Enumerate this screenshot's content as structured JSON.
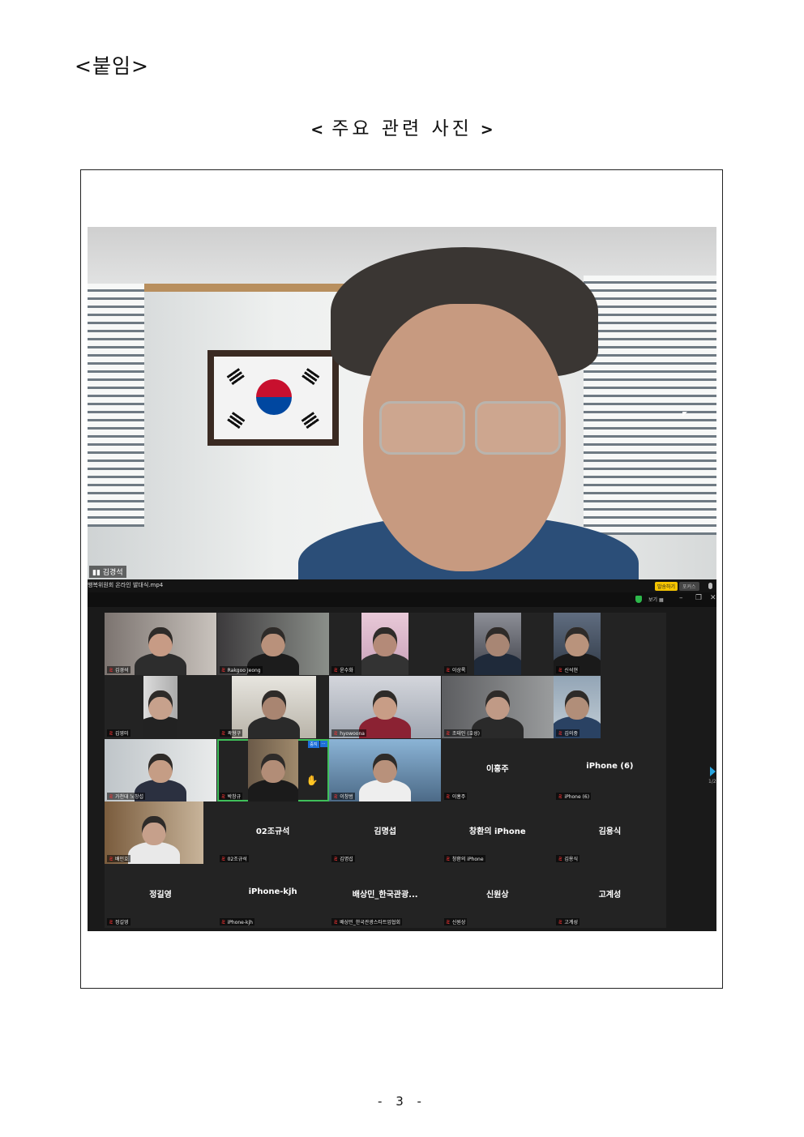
{
  "document": {
    "attachment_title": "<붙임>",
    "heading_open": "<",
    "heading_text": "주요 관련 사진",
    "heading_close": ">",
    "page_number": "- 3 -"
  },
  "speaker_view": {
    "speaker_name": "김경석"
  },
  "zoom_window": {
    "file_name": "행복위원회 온라인 발대식.mp4",
    "record_badge": "발송하기",
    "focus_button": "포커스",
    "view_button": "보기 ▦",
    "minimize": "–",
    "restore": "❐",
    "close": "✕",
    "page_indicator": "1/2",
    "stop_video_label": "중지",
    "more_label": "···",
    "hand_icon": "✋"
  },
  "participants": [
    {
      "label": "김경석",
      "bigname": ""
    },
    {
      "label": "Rakgoo Jeong",
      "bigname": ""
    },
    {
      "label": "윤수화",
      "bigname": ""
    },
    {
      "label": "이상록",
      "bigname": ""
    },
    {
      "label": "신석현",
      "bigname": ""
    },
    {
      "label": "김영미",
      "bigname": ""
    },
    {
      "label": "곽형구",
      "bigname": ""
    },
    {
      "label": "hyowoona",
      "bigname": ""
    },
    {
      "label": "조태인 (호성)",
      "bigname": ""
    },
    {
      "label": "김의중",
      "bigname": ""
    },
    {
      "label": "가천대 노창섭",
      "bigname": ""
    },
    {
      "label": "박창규",
      "bigname": ""
    },
    {
      "label": "이창범",
      "bigname": ""
    },
    {
      "label": "이홍주",
      "bigname": "이홍주"
    },
    {
      "label": "iPhone (6)",
      "bigname": "iPhone (6)"
    },
    {
      "label": "배인호",
      "bigname": ""
    },
    {
      "label": "02조규석",
      "bigname": "02조규석"
    },
    {
      "label": "김명섭",
      "bigname": "김명섭"
    },
    {
      "label": "창환의 iPhone",
      "bigname": "창환의 iPhone"
    },
    {
      "label": "김용식",
      "bigname": "김용식"
    },
    {
      "label": "정길영",
      "bigname": "정길영"
    },
    {
      "label": "iPhone-kjh",
      "bigname": "iPhone-kjh"
    },
    {
      "label": "배상민_한국관광스타트업협회",
      "bigname": "배상민_한국관광..."
    },
    {
      "label": "신원상",
      "bigname": "신원상"
    },
    {
      "label": "고계성",
      "bigname": "고계성"
    }
  ],
  "colors": {
    "zoom_bg": "#1a1a1a",
    "tile_bg": "#232323",
    "active_speaker_border": "#3fbf5a",
    "muted_icon": "#e33333",
    "zoom_accent": "#1e6fd9"
  }
}
